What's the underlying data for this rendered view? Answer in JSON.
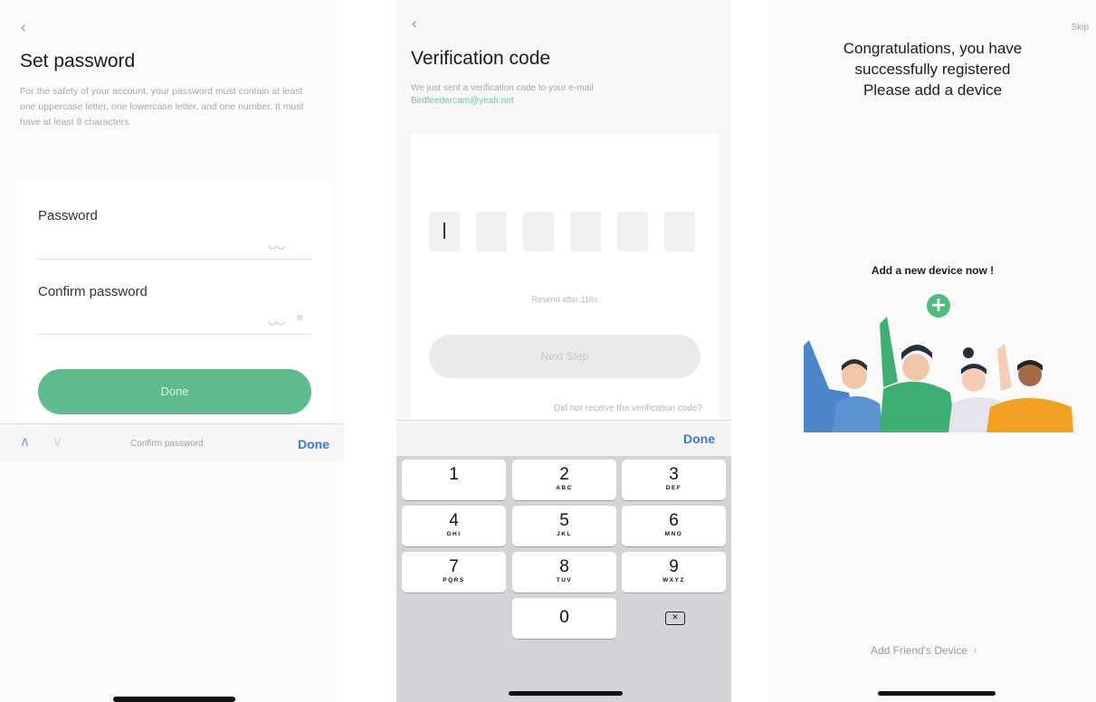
{
  "set_password": {
    "back_glyph": "‹",
    "title": "Set password",
    "description": "For the safety of your account, your password must contain at least one uppercase letter, one lowercase letter, and one number. It must have at least 8 characters.",
    "password_label": "Password",
    "confirm_label": "Confirm password",
    "done_button": "Done",
    "toolbar": {
      "up": "∧",
      "down": "∨",
      "label": "Confirm password",
      "done": "Done"
    }
  },
  "verification": {
    "back_glyph": "‹",
    "title": "Verification code",
    "description": "We just sent a verification code to your e-mail",
    "email": "Birdfeedercam@yeah.net",
    "resend": "Resend after 116s",
    "next_button": "Next Step",
    "not_received": "Did not receive the verification code?",
    "toolbar_done": "Done",
    "keypad": [
      {
        "num": "1",
        "letters": ""
      },
      {
        "num": "2",
        "letters": "ABC"
      },
      {
        "num": "3",
        "letters": "DEF"
      },
      {
        "num": "4",
        "letters": "GHI"
      },
      {
        "num": "5",
        "letters": "JKL"
      },
      {
        "num": "6",
        "letters": "MNO"
      },
      {
        "num": "7",
        "letters": "PQRS"
      },
      {
        "num": "8",
        "letters": "TUV"
      },
      {
        "num": "9",
        "letters": "WXYZ"
      },
      {
        "num": "0",
        "letters": ""
      }
    ]
  },
  "registered": {
    "skip": "Skip",
    "congrats_line1": "Congratulations, you have",
    "congrats_line2": "successfully registered",
    "congrats_line3": "Please add a device",
    "add_new": "Add a new device now !",
    "plus_glyph": "+",
    "add_friend": "Add Friend's Device",
    "add_friend_chevron": "›"
  },
  "colors": {
    "accent_green": "#5fba8c",
    "ios_blue": "#3b78d6",
    "email_teal": "#6fbfae"
  },
  "icons": [
    "back-chevron-icon",
    "eye-closed-icon",
    "clear-icon",
    "chevron-up-icon",
    "chevron-down-icon",
    "backspace-icon",
    "plus-icon",
    "chevron-right-icon"
  ]
}
